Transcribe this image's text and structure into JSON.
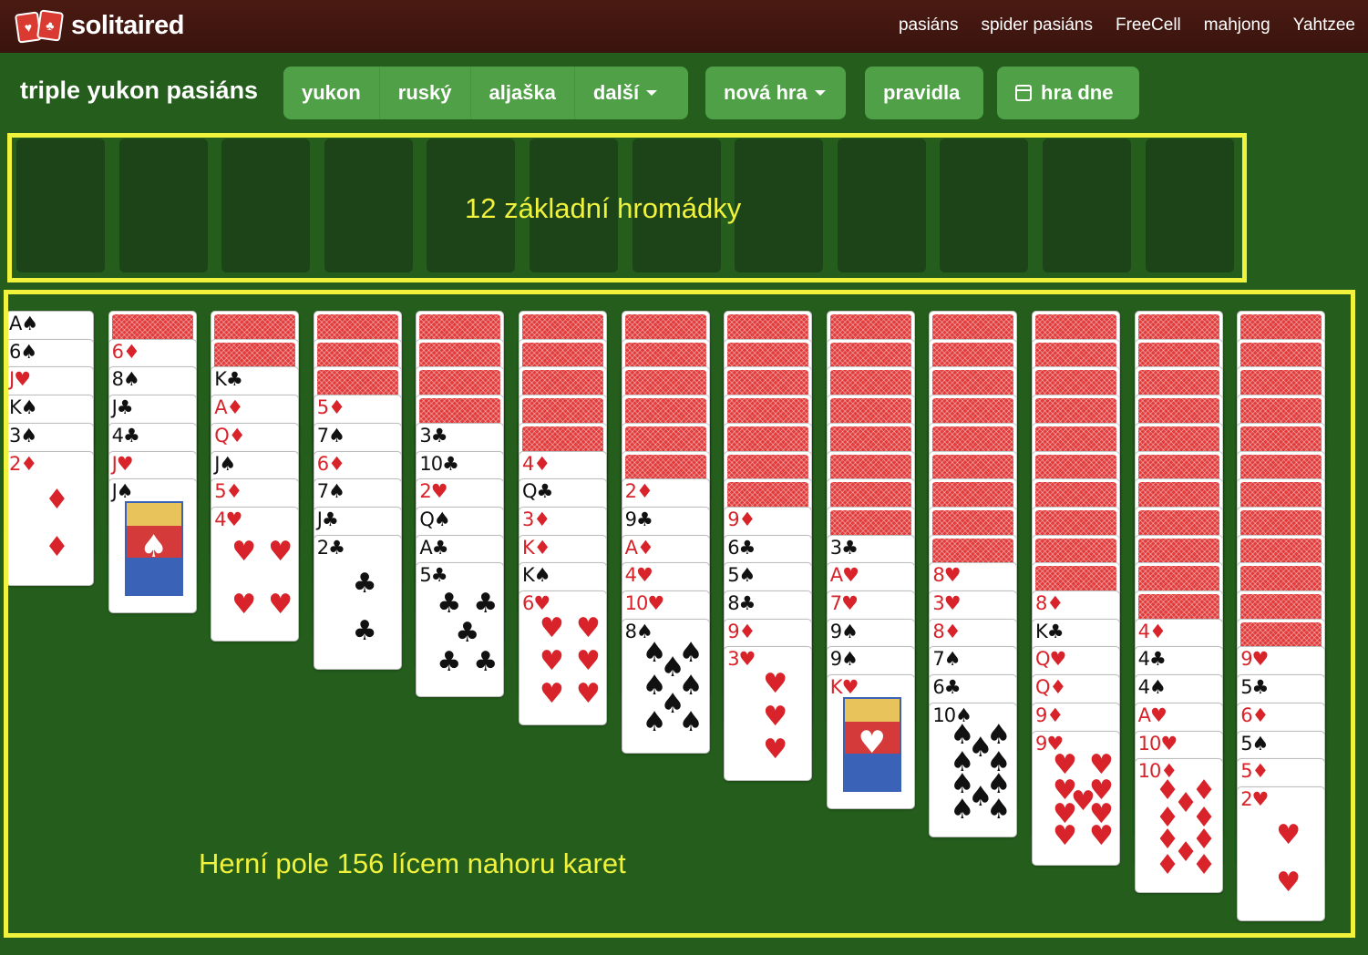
{
  "header": {
    "logo_text": "solitaired",
    "logo_suits": [
      "♥",
      "♣"
    ],
    "nav": [
      "pasiáns",
      "spider pasiáns",
      "FreeCell",
      "mahjong",
      "Yahtzee"
    ]
  },
  "toolbar": {
    "game_title": "triple yukon pasiáns",
    "variants": [
      "yukon",
      "ruský",
      "aljaška"
    ],
    "more_label": "další",
    "new_game_label": "nová hra",
    "rules_label": "pravidla",
    "daily_label": "hra dne"
  },
  "foundations": {
    "count": 12,
    "label": "12 základní hromádky"
  },
  "tableau": {
    "label": "Herní pole 156 lícem nahoru karet",
    "columns": [
      {
        "down": 0,
        "cards": [
          "A♠",
          "6♠",
          "J♥",
          "K♠",
          "3♠",
          "2♦"
        ]
      },
      {
        "down": 1,
        "cards": [
          "6♦",
          "8♠",
          "J♣",
          "4♣",
          "J♥",
          "J♠"
        ]
      },
      {
        "down": 2,
        "cards": [
          "K♣",
          "A♦",
          "Q♦",
          "J♠",
          "5♦",
          "4♥"
        ]
      },
      {
        "down": 3,
        "cards": [
          "5♦",
          "7♠",
          "6♦",
          "7♠",
          "J♣",
          "2♣"
        ]
      },
      {
        "down": 4,
        "cards": [
          "3♣",
          "10♣",
          "2♥",
          "Q♠",
          "A♣",
          "5♣"
        ]
      },
      {
        "down": 5,
        "cards": [
          "4♦",
          "Q♣",
          "3♦",
          "K♦",
          "K♠",
          "6♥"
        ]
      },
      {
        "down": 6,
        "cards": [
          "2♦",
          "9♣",
          "A♦",
          "4♥",
          "10♥",
          "8♠"
        ]
      },
      {
        "down": 7,
        "cards": [
          "9♦",
          "6♣",
          "5♠",
          "8♣",
          "9♦",
          "3♥"
        ]
      },
      {
        "down": 8,
        "cards": [
          "3♣",
          "A♥",
          "7♥",
          "9♠",
          "9♠",
          "K♥"
        ]
      },
      {
        "down": 9,
        "cards": [
          "8♥",
          "3♥",
          "8♦",
          "7♠",
          "6♣",
          "10♠"
        ]
      },
      {
        "down": 10,
        "cards": [
          "8♦",
          "K♣",
          "Q♥",
          "Q♦",
          "9♦",
          "9♥"
        ]
      },
      {
        "down": 11,
        "cards": [
          "4♦",
          "4♣",
          "4♠",
          "A♥",
          "10♥",
          "10♦"
        ]
      },
      {
        "down": 12,
        "cards": [
          "9♥",
          "5♣",
          "6♦",
          "5♠",
          "5♦",
          "2♥"
        ]
      }
    ]
  },
  "colors": {
    "felt": "#245d1c",
    "highlight": "#f0f23c",
    "button": "#4fa046",
    "card_back": "#e13b3b"
  }
}
